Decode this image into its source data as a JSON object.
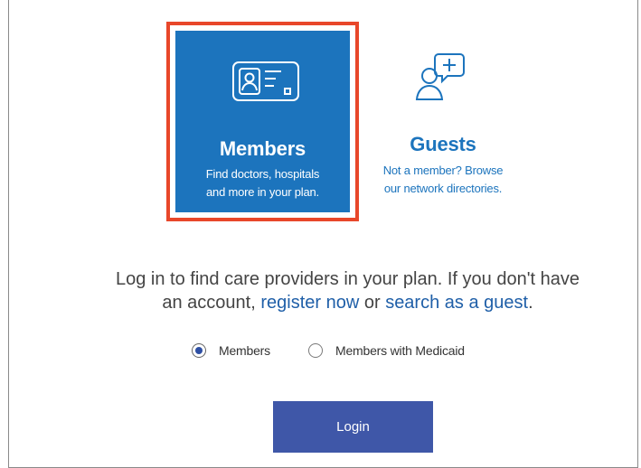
{
  "cards": {
    "members": {
      "title": "Members",
      "desc_line1": "Find doctors, hospitals",
      "desc_line2": "and more in your plan."
    },
    "guests": {
      "title": "Guests",
      "desc_line1": "Not a member? Browse",
      "desc_line2": "our network directories."
    }
  },
  "intro": {
    "line1": "Log in to find care providers in your plan. If you don't have",
    "line2_prefix": "an account, ",
    "register_link": "register now",
    "line2_middle": " or ",
    "guest_link": "search as a guest",
    "line2_suffix": "."
  },
  "radios": {
    "options": [
      {
        "label": "Members",
        "checked": true
      },
      {
        "label": "Members with Medicaid",
        "checked": false
      }
    ]
  },
  "login": {
    "label": "Login"
  },
  "colors": {
    "members_card_bg": "#1c74bd",
    "selection_border": "#e8472a",
    "link": "#1f5fa8",
    "login_button": "#3f57a8"
  },
  "icons": {
    "members": "id-card-icon",
    "guests": "user-chat-plus-icon"
  }
}
